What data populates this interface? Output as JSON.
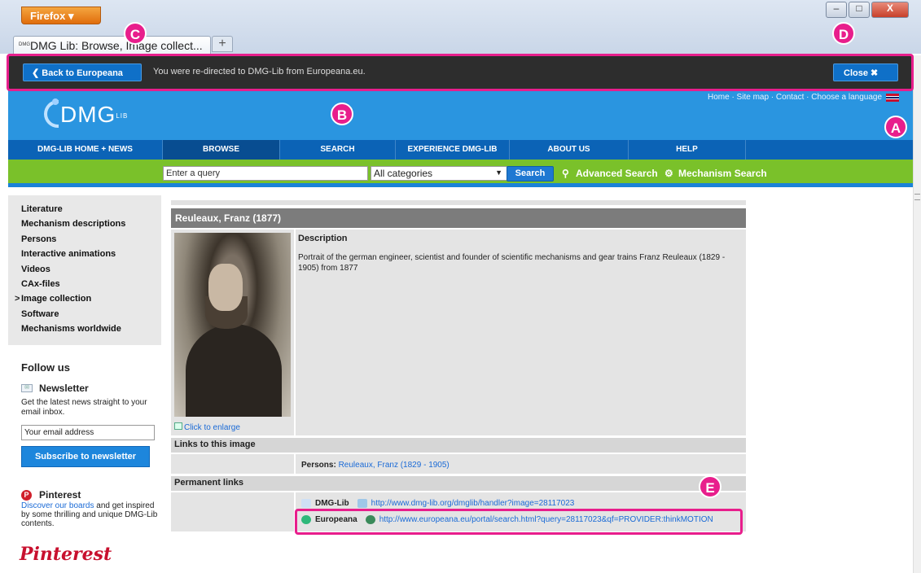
{
  "browser": {
    "menu_label": "Firefox ▾",
    "tab_title": "DMG Lib: Browse, Image collect...",
    "new_tab": "+",
    "win_min": "–",
    "win_max": "□",
    "win_close": "X"
  },
  "redirect_bar": {
    "back_label": "❮  Back to Europeana",
    "message": "You were re-directed to DMG-Lib from Europeana.eu.",
    "close_label": "Close  ✖"
  },
  "markers": {
    "a": "A",
    "b": "B",
    "c": "C",
    "d": "D",
    "e": "E"
  },
  "header": {
    "logo_text": "DMG",
    "logo_sub": "LIB",
    "top_links": "Home  · Site map  · Contact  · Choose a language"
  },
  "nav": [
    "DMG-LIB HOME + NEWS",
    "BROWSE",
    "SEARCH",
    "EXPERIENCE DMG-LIB",
    "ABOUT US",
    "HELP"
  ],
  "search": {
    "query_placeholder": "Enter a query",
    "category": "All categories",
    "button": "Search",
    "advanced": "Advanced Search",
    "mechanism": "Mechanism Search"
  },
  "sidebar": {
    "items": [
      "Literature",
      "Mechanism descriptions",
      "Persons",
      "Interactive animations",
      "Videos",
      "CAx-files",
      "Image collection",
      "Software",
      "Mechanisms worldwide"
    ],
    "selected_marker": ">",
    "follow_us": "Follow us",
    "newsletter_title": "Newsletter",
    "newsletter_desc": "Get the latest news straight to your email inbox.",
    "email_placeholder": "Your email address",
    "subscribe": "Subscribe to newsletter",
    "pinterest_title": "Pinterest",
    "pinterest_link": "Discover our boards",
    "pinterest_desc": " and get inspired by some thrilling and unique DMG-Lib contents.",
    "pinterest_logo": "Pinterest"
  },
  "content": {
    "title": "Reuleaux, Franz (1877)",
    "click_enlarge": "Click to enlarge",
    "description_label": "Description",
    "description": "Portrait of the german engineer, scientist and founder of scientific mechanisms and gear trains Franz Reuleaux (1829 - 1905) from 1877",
    "links_label": "Links to this image",
    "persons_label": "Persons:",
    "persons_value": "Reuleaux, Franz (1829 - 1905)",
    "permanent_label": "Permanent links",
    "dmglib_label": "DMG-Lib",
    "dmglib_url": "http://www.dmg-lib.org/dmglib/handler?image=28117023",
    "europeana_label": "Europeana",
    "europeana_url": "http://www.europeana.eu/portal/search.html?query=28117023&qf=PROVIDER:thinkMOTION"
  },
  "colors": {
    "annotation": "#e81e8c",
    "header_blue": "#2a95e0",
    "nav_blue": "#0b63b6",
    "green": "#7ac12a"
  }
}
